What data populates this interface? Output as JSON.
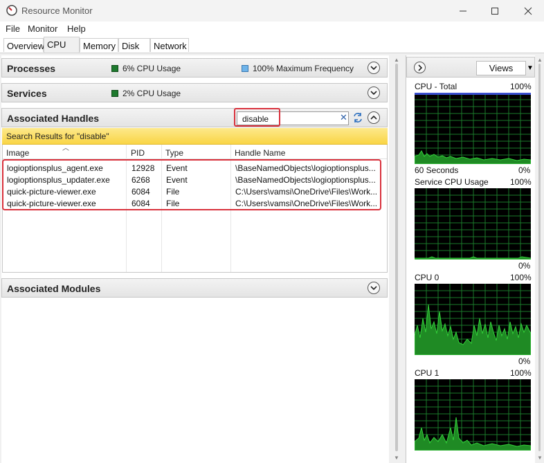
{
  "window": {
    "title": "Resource Monitor"
  },
  "menu": {
    "file": "File",
    "monitor": "Monitor",
    "help": "Help"
  },
  "tabs": [
    "Overview",
    "CPU",
    "Memory",
    "Disk",
    "Network"
  ],
  "active_tab": "CPU",
  "processes": {
    "title": "Processes",
    "cpu_usage": "6% CPU Usage",
    "max_frequency": "100% Maximum Frequency"
  },
  "services": {
    "title": "Services",
    "cpu_usage": "2% CPU Usage"
  },
  "handles": {
    "title": "Associated Handles",
    "search_value": "disable",
    "results_banner": "Search Results for \"disable\"",
    "columns": [
      "Image",
      "PID",
      "Type",
      "Handle Name"
    ],
    "rows": [
      {
        "image": "logioptionsplus_agent.exe",
        "pid": "12928",
        "type": "Event",
        "handle": "\\BaseNamedObjects\\logioptionsplus..."
      },
      {
        "image": "logioptionsplus_updater.exe",
        "pid": "6268",
        "type": "Event",
        "handle": "\\BaseNamedObjects\\logioptionsplus..."
      },
      {
        "image": "quick-picture-viewer.exe",
        "pid": "6084",
        "type": "File",
        "handle": "C:\\Users\\vamsi\\OneDrive\\Files\\Work..."
      },
      {
        "image": "quick-picture-viewer.exe",
        "pid": "6084",
        "type": "File",
        "handle": "C:\\Users\\vamsi\\OneDrive\\Files\\Work..."
      }
    ]
  },
  "modules": {
    "title": "Associated Modules"
  },
  "right_panel": {
    "views_label": "Views",
    "graphs": [
      {
        "title": "CPU - Total",
        "max": "100%",
        "footer_left": "60 Seconds",
        "footer_right": "0%"
      },
      {
        "title": "Service CPU Usage",
        "max": "100%",
        "footer_right": "0%"
      },
      {
        "title": "CPU 0",
        "max": "100%",
        "footer_right": "0%"
      },
      {
        "title": "CPU 1",
        "max": "100%"
      }
    ]
  },
  "colors": {
    "graph_line": "#33d13a",
    "graph_fill": "#1f8a24",
    "grid": "#1a7a2a",
    "highlight": "#d9313c",
    "banner": "#f9d545"
  }
}
